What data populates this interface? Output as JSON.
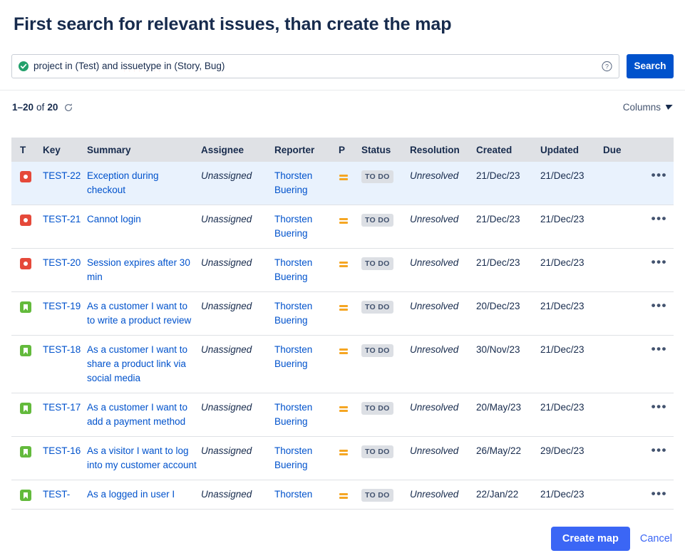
{
  "header": {
    "title": "First search for relevant issues, than create the map"
  },
  "search": {
    "jql_prefix": "project in (Test) and ",
    "jql_misspelled": "issuetype",
    "jql_suffix": " in (Story, Bug)",
    "jql_full": "project in (Test) and issuetype in (Story, Bug)",
    "valid_icon": "check-circle-icon",
    "help_icon": "question-circle-icon",
    "search_label": "Search"
  },
  "results": {
    "range": "1–20",
    "of": "of",
    "total": "20",
    "refresh_icon": "refresh-icon",
    "columns_label": "Columns"
  },
  "table": {
    "columns": [
      "T",
      "Key",
      "Summary",
      "Assignee",
      "Reporter",
      "P",
      "Status",
      "Resolution",
      "Created",
      "Updated",
      "Due",
      ""
    ],
    "rows": [
      {
        "type": "bug",
        "key": "TEST-22",
        "summary": "Exception during checkout",
        "assignee": "Unassigned",
        "reporter": "Thorsten Buering",
        "priority": "medium",
        "status": "TO DO",
        "resolution": "Unresolved",
        "created": "21/Dec/23",
        "updated": "21/Dec/23",
        "due": "",
        "actions": "•••",
        "highlight": true
      },
      {
        "type": "bug",
        "key": "TEST-21",
        "summary": "Cannot login",
        "assignee": "Unassigned",
        "reporter": "Thorsten Buering",
        "priority": "medium",
        "status": "TO DO",
        "resolution": "Unresolved",
        "created": "21/Dec/23",
        "updated": "21/Dec/23",
        "due": "",
        "actions": "•••",
        "highlight": false
      },
      {
        "type": "bug",
        "key": "TEST-20",
        "summary": "Session expires after 30 min",
        "assignee": "Unassigned",
        "reporter": "Thorsten Buering",
        "priority": "medium",
        "status": "TO DO",
        "resolution": "Unresolved",
        "created": "21/Dec/23",
        "updated": "21/Dec/23",
        "due": "",
        "actions": "•••",
        "highlight": false
      },
      {
        "type": "story",
        "key": "TEST-19",
        "summary": "As a customer I want to to write a product review",
        "assignee": "Unassigned",
        "reporter": "Thorsten Buering",
        "priority": "medium",
        "status": "TO DO",
        "resolution": "Unresolved",
        "created": "20/Dec/23",
        "updated": "21/Dec/23",
        "due": "",
        "actions": "•••",
        "highlight": false
      },
      {
        "type": "story",
        "key": "TEST-18",
        "summary": "As a customer I want to share a product link via social media",
        "assignee": "Unassigned",
        "reporter": "Thorsten Buering",
        "priority": "medium",
        "status": "TO DO",
        "resolution": "Unresolved",
        "created": "30/Nov/23",
        "updated": "21/Dec/23",
        "due": "",
        "actions": "•••",
        "highlight": false
      },
      {
        "type": "story",
        "key": "TEST-17",
        "summary": "As a customer I want to add a payment method",
        "assignee": "Unassigned",
        "reporter": "Thorsten Buering",
        "priority": "medium",
        "status": "TO DO",
        "resolution": "Unresolved",
        "created": "20/May/23",
        "updated": "21/Dec/23",
        "due": "",
        "actions": "•••",
        "highlight": false
      },
      {
        "type": "story",
        "key": "TEST-16",
        "summary": "As a visitor I want to log into my customer account",
        "assignee": "Unassigned",
        "reporter": "Thorsten Buering",
        "priority": "medium",
        "status": "TO DO",
        "resolution": "Unresolved",
        "created": "26/May/22",
        "updated": "29/Dec/23",
        "due": "",
        "actions": "•••",
        "highlight": false
      },
      {
        "type": "story",
        "key": "TEST-",
        "summary": "As a logged in user I",
        "assignee": "Unassigned",
        "reporter": "Thorsten",
        "priority": "medium",
        "status": "TO DO",
        "resolution": "Unresolved",
        "created": "22/Jan/22",
        "updated": "21/Dec/23",
        "due": "",
        "actions": "•••",
        "highlight": false
      }
    ]
  },
  "footer": {
    "create_map_label": "Create map",
    "cancel_label": "Cancel"
  },
  "colors": {
    "primary_blue": "#0052cc",
    "button_blue": "#3b66f5",
    "link_blue": "#0052cc",
    "bug_red": "#e5493a",
    "story_green": "#63ba3c",
    "priority_orange": "#f5a623",
    "header_gray": "#dfe1e5",
    "row_highlight": "#e9f2fd",
    "text_dark": "#172b4d"
  }
}
